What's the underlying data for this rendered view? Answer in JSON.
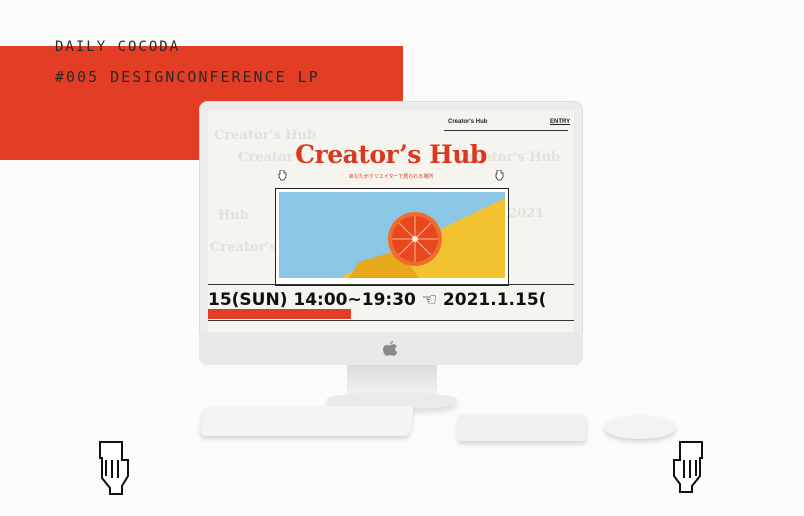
{
  "brand": {
    "line1": "DAILY COCODA",
    "line2": "#005 DESIGNCONFERENCE LP"
  },
  "site": {
    "nav_name": "Creator's Hub",
    "nav_entry": "ENTRY",
    "hero_title": "Creator’s Hub",
    "hero_subtitle": "あなたがクリエイターで居られる場所",
    "ticker_text": "15(SUN) 14:00~19:30 ☜ 2021.1.15(",
    "ghost_texts": [
      "Creator's Hub",
      "Creator's",
      "Hub",
      "2021",
      "Creator's Hub",
      "Creator's Hub"
    ]
  },
  "colors": {
    "accent_red": "#e43d26",
    "background": "#fbfbf9"
  },
  "icons": {
    "left_hand": "pointing-hand-down-icon",
    "right_hand": "pointing-hand-down-icon",
    "apple_logo": "apple-logo-icon"
  }
}
